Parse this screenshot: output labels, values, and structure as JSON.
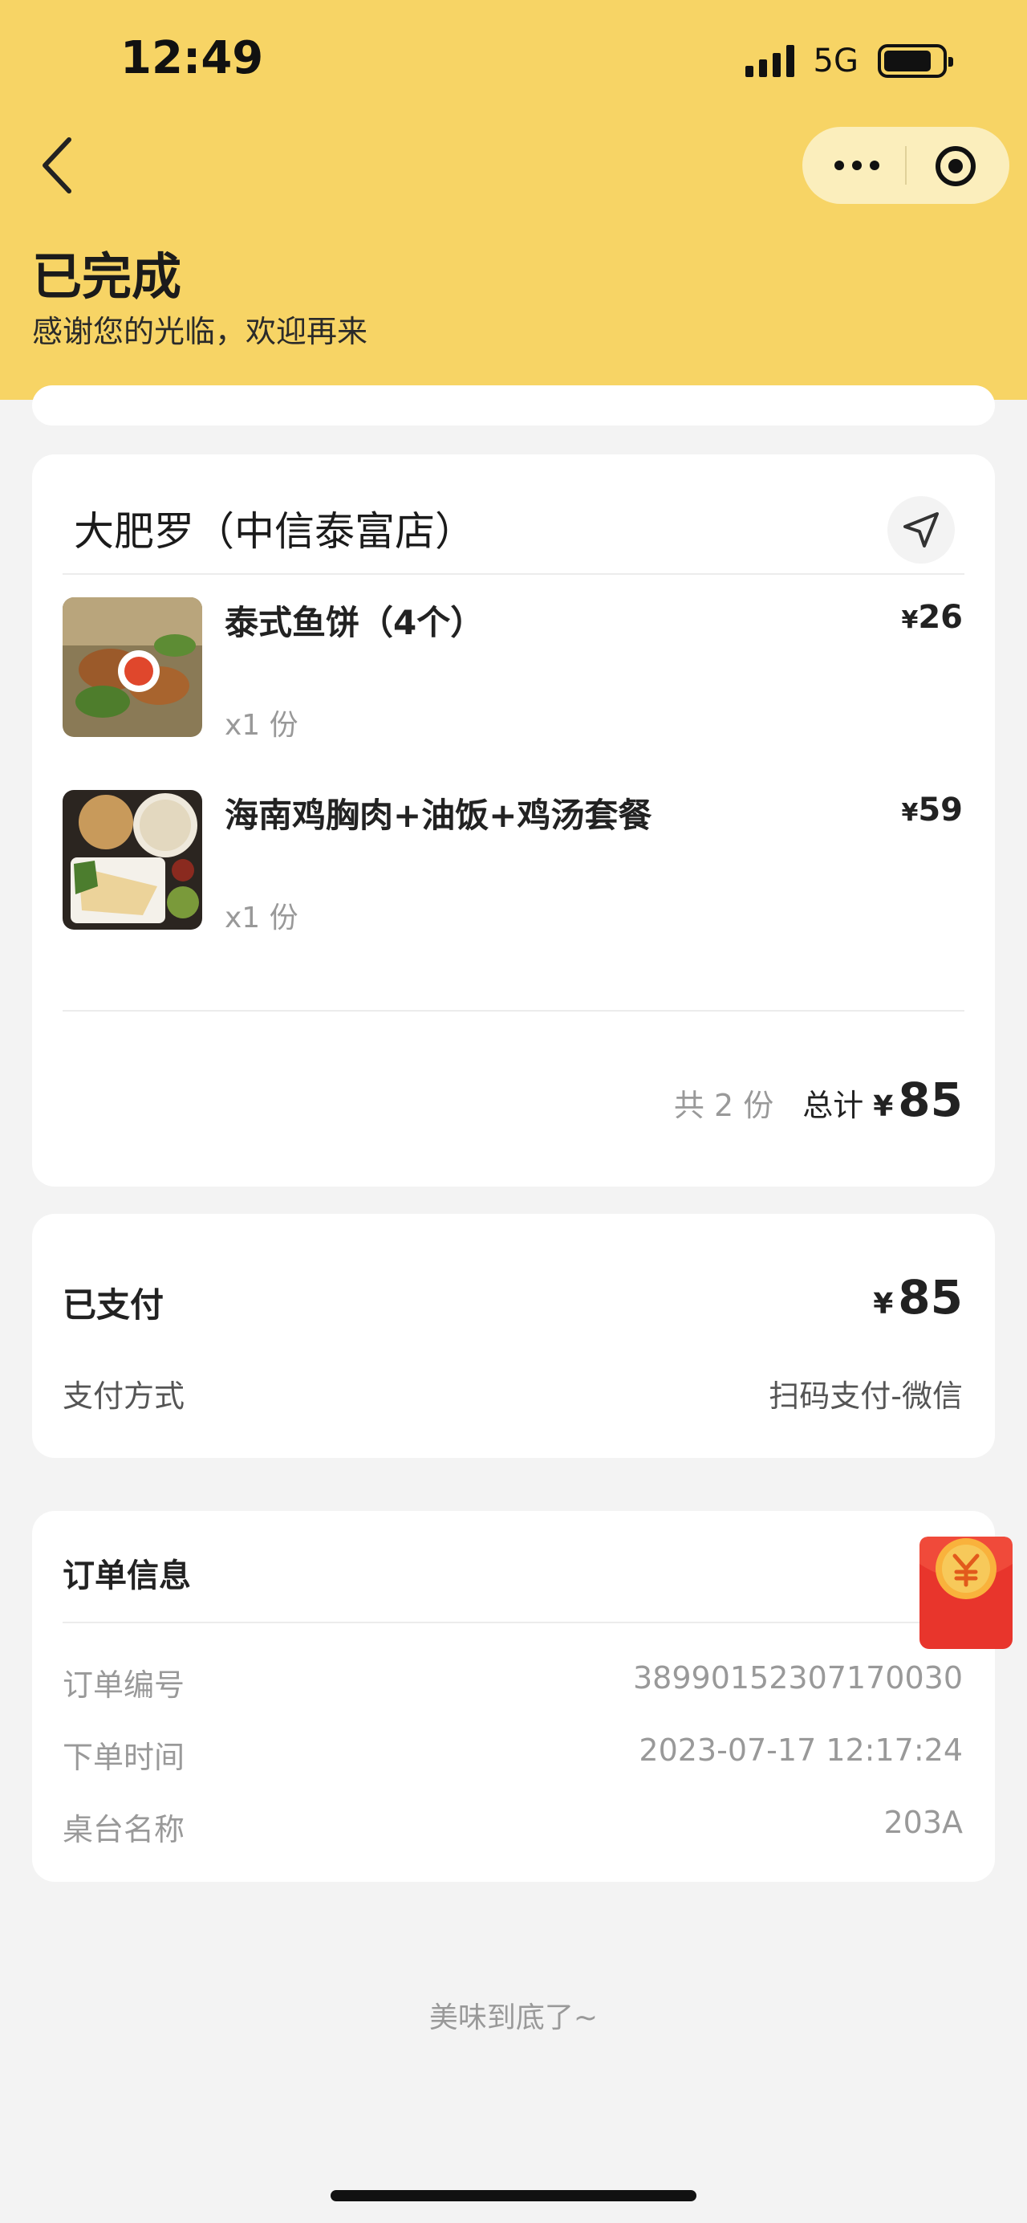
{
  "status_bar": {
    "time": "12:49",
    "network": "5G"
  },
  "header": {
    "title": "已完成",
    "subtitle": "感谢您的光临，欢迎再来"
  },
  "store": {
    "name": "大肥罗（中信泰富店）",
    "items": [
      {
        "name": "泰式鱼饼（4个）",
        "qty": "x1 份",
        "currency": "¥",
        "price": "26"
      },
      {
        "name": "海南鸡胸肉+油饭+鸡汤套餐",
        "qty": "x1 份",
        "currency": "¥",
        "price": "59"
      }
    ],
    "count_text": "共 2 份",
    "total_label": "总计",
    "total_currency": "¥",
    "total_value": "85"
  },
  "payment": {
    "label": "已支付",
    "currency": "¥",
    "amount": "85",
    "method_label": "支付方式",
    "method_value": "扫码支付-微信"
  },
  "order_info": {
    "title": "订单信息",
    "rows": [
      {
        "label": "订单编号",
        "value": "38990152307170030"
      },
      {
        "label": "下单时间",
        "value": "2023-07-17 12:17:24"
      },
      {
        "label": "桌台名称",
        "value": "203A"
      }
    ]
  },
  "footer": {
    "text": "美味到底了~"
  },
  "colors": {
    "header_bg": "#f7d465",
    "page_bg": "#f3f3f3",
    "red_packet": "#e8352c"
  }
}
